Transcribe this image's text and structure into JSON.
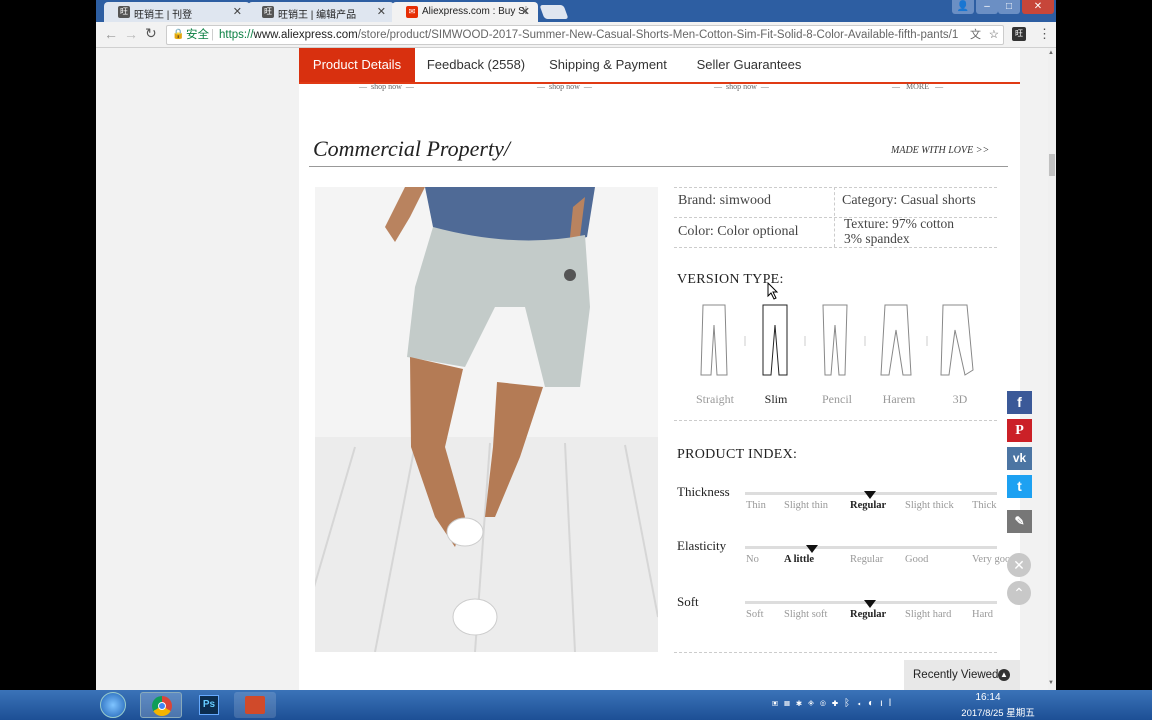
{
  "browser": {
    "tabs": [
      {
        "title": "旺销王 | 刊登",
        "icon": "wangxiaowang-icon"
      },
      {
        "title": "旺销王 | 编辑产品",
        "icon": "wangxiaowang-icon"
      },
      {
        "title": "Aliexpress.com : Buy Si",
        "icon": "aliexpress-icon"
      }
    ],
    "secure_label": "安全",
    "url_scheme": "https://",
    "url_host": "www.aliexpress.com",
    "url_path": "/store/product/SIMWOOD-2017-Summer-New-Casual-Shorts-Men-Cotton-Sim-Fit-Solid-8-Color-Available-fifth-pants/1"
  },
  "nav": {
    "tabs": [
      "Product Details",
      "Feedback (2558)",
      "Shipping & Payment",
      "Seller Guarantees"
    ],
    "active": 0,
    "shop_links": [
      "shop now",
      "shop now",
      "shop now",
      "MORE"
    ]
  },
  "section": {
    "title": "Commercial Property/",
    "made_with_love": "MADE WITH LOVE >>"
  },
  "attributes": {
    "brand": "Brand:  simwood",
    "category": "Category:  Casual shorts",
    "color": "Color:  Color optional",
    "texture_line1": "Texture:  97% cotton",
    "texture_line2": "3% spandex"
  },
  "version_type": {
    "title": "VERSION TYPE:",
    "options": [
      "Straight",
      "Slim",
      "Pencil",
      "Harem",
      "3D"
    ],
    "selected": "Slim"
  },
  "product_index": {
    "title": "PRODUCT INDEX:",
    "rows": [
      {
        "name": "Thickness",
        "ticks": [
          "Thin",
          "Slight thin",
          "Regular",
          "Slight thick",
          "Thick"
        ],
        "selected_index": 2
      },
      {
        "name": "Elasticity",
        "ticks": [
          "No",
          "A little",
          "Regular",
          "Good",
          "Very good"
        ],
        "selected_index": 1
      },
      {
        "name": "Soft",
        "ticks": [
          "Soft",
          "Slight soft",
          "Regular",
          "Slight hard",
          "Hard"
        ],
        "selected_index": 2
      }
    ]
  },
  "social": {
    "facebook": "f",
    "pinterest": "P",
    "vk": "vk",
    "twitter": "t"
  },
  "recently_viewed": "Recently Viewed",
  "taskbar": {
    "time": "16:14",
    "date": "2017/8/25 星期五"
  },
  "colors": {
    "tab_active": "#d8300f",
    "accent_line": "#e03a14",
    "facebook": "#3b5998",
    "pinterest": "#cb2027",
    "vk": "#4c75a3",
    "twitter": "#1da1f2"
  }
}
